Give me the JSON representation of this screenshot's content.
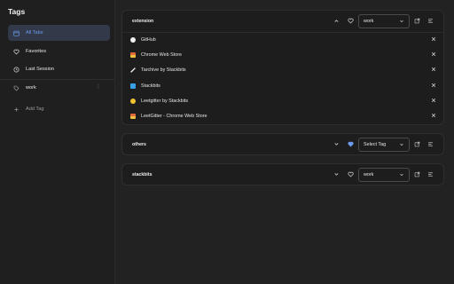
{
  "sidebar": {
    "title": "Tags",
    "items": [
      {
        "label": "All Tabs",
        "icon": "calendar-icon",
        "active": true
      },
      {
        "label": "Favorites",
        "icon": "heart-icon",
        "active": false
      },
      {
        "label": "Last Session",
        "icon": "clock-icon",
        "active": false
      },
      {
        "label": "work",
        "icon": "tag-icon",
        "active": false
      }
    ],
    "more_glyph": "⋮",
    "add_tag_label": "Add Tag"
  },
  "groups": [
    {
      "name": "extension",
      "selected_tag": "work",
      "expanded": true,
      "favorite": false,
      "tabs": [
        {
          "title": "GitHub",
          "icon": "github-icon",
          "color": "#f0f0f0"
        },
        {
          "title": "Chrome Web Store",
          "icon": "chrome-web-store-icon",
          "color": "#e06a3a"
        },
        {
          "title": "Tarchive by Stackbits",
          "icon": "tarchive-icon",
          "color": "#f0f0f0"
        },
        {
          "title": "Stackbits",
          "icon": "stackbits-icon",
          "color": "#3aa0e6"
        },
        {
          "title": "Leetgitter by Stackbits",
          "icon": "leetgitter-icon",
          "color": "#f2c230"
        },
        {
          "title": "LeetGitter - Chrome Web Store",
          "icon": "chrome-web-store-icon",
          "color": "#e06a3a"
        }
      ]
    },
    {
      "name": "others",
      "selected_tag": "Select Tag",
      "expanded": false,
      "favorite": true,
      "tabs": []
    },
    {
      "name": "stackbits",
      "selected_tag": "work",
      "expanded": false,
      "favorite": false,
      "tabs": []
    }
  ],
  "colors": {
    "accent": "#6d9cf0",
    "active_bg": "#323a4a",
    "favorite": "#6d9cf0"
  }
}
